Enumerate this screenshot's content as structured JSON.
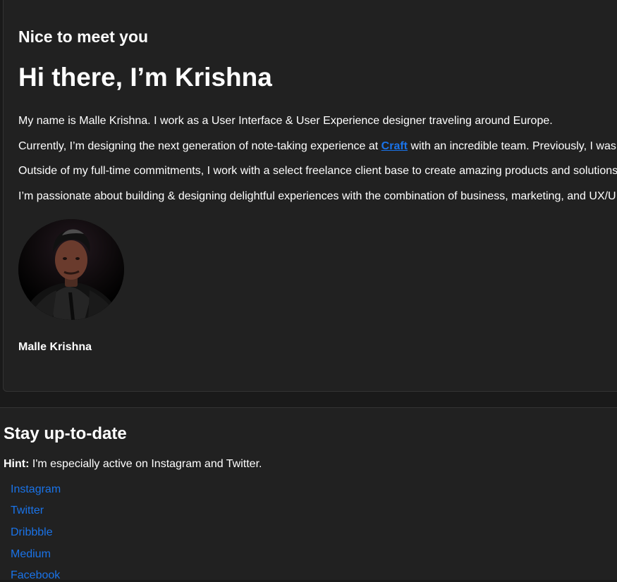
{
  "about": {
    "eyebrow": "Nice to meet you",
    "headline": "Hi there, I’m Krishna",
    "bio_1": "My name is Malle Krishna. I work as a User Interface & User Experience designer traveling around Europe.",
    "bio_2_before": "Currently, I’m designing the next generation of note-taking experience at ",
    "bio_2_link": "Craft",
    "bio_2_after": " with an incredible team. Previously, I was",
    "bio_3": "Outside of my full-time commitments, I work with a select freelance client base to create amazing products and solutions",
    "bio_4": "I’m passionate about building & designing delightful experiences with the combination of business, marketing, and UX/UI",
    "name": "Malle Krishna",
    "link_color": "#1a73e8",
    "avatar_icon": "profile-photo"
  },
  "social": {
    "title": "Stay up-to-date",
    "hint_label": "Hint:",
    "hint_text": " I'm especially active on Instagram and Twitter.",
    "links": [
      {
        "label": "Instagram"
      },
      {
        "label": "Twitter"
      },
      {
        "label": "Dribbble"
      },
      {
        "label": "Medium"
      },
      {
        "label": "Facebook"
      }
    ]
  }
}
